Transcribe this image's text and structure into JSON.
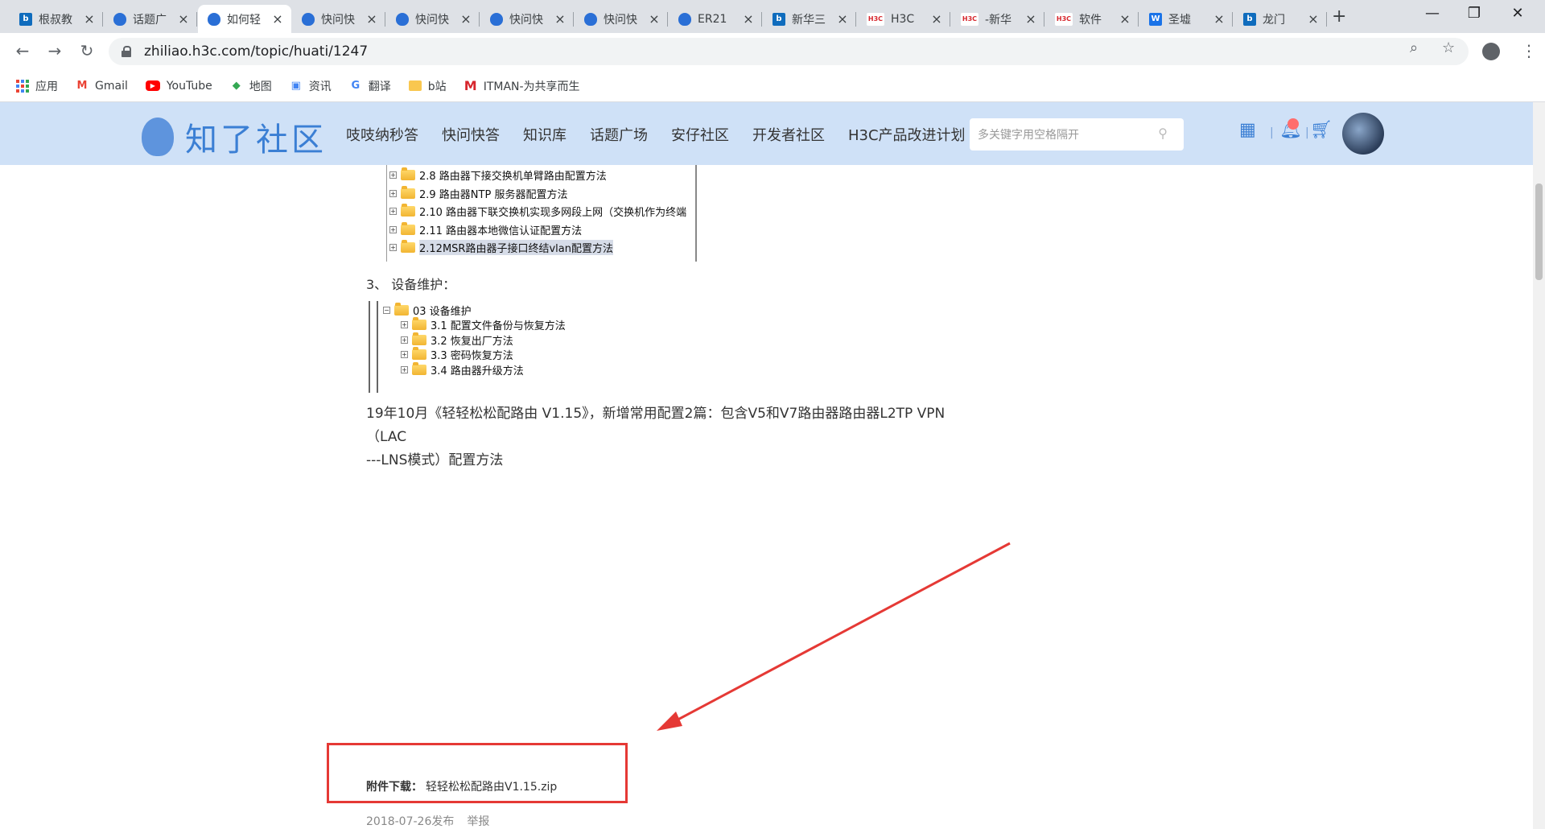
{
  "browser": {
    "tabs": [
      {
        "icon": "bing",
        "title": "根叔教"
      },
      {
        "icon": "zhiliao",
        "title": "话题广"
      },
      {
        "icon": "zhiliao",
        "title": "如何轻"
      },
      {
        "icon": "zhiliao",
        "title": "快问快"
      },
      {
        "icon": "zhiliao",
        "title": "快问快"
      },
      {
        "icon": "zhiliao",
        "title": "快问快"
      },
      {
        "icon": "zhiliao",
        "title": "快问快"
      },
      {
        "icon": "zhiliao",
        "title": "ER21"
      },
      {
        "icon": "bing",
        "title": "新华三"
      },
      {
        "icon": "h3c",
        "title": "H3C"
      },
      {
        "icon": "h3c",
        "title": "-新华"
      },
      {
        "icon": "h3c",
        "title": "软件"
      },
      {
        "icon": "wanfang",
        "title": "圣墟"
      },
      {
        "icon": "bing",
        "title": "龙门"
      }
    ],
    "active_tab_index": 2,
    "url": "zhiliao.h3c.com/topic/huati/1247",
    "bookmarks": [
      "应用",
      "Gmail",
      "YouTube",
      "地图",
      "资讯",
      "翻译",
      "b站",
      "ITMAN-为共享而生"
    ]
  },
  "site": {
    "logo_text": "知了社区",
    "nav": [
      "吱吱纳秒答",
      "快问快答",
      "知识库",
      "话题广场",
      "安仔社区",
      "开发者社区",
      "H3C产品改进计划"
    ],
    "search_placeholder": "多关键字用空格隔开",
    "separator": "|"
  },
  "content": {
    "tree1": [
      {
        "label": "2.8 路由器下接交换机单臂路由配置方法",
        "selected": false
      },
      {
        "label": "2.9 路由器NTP 服务器配置方法",
        "selected": false
      },
      {
        "label": "2.10 路由器下联交换机实现多网段上网（交换机作为终端",
        "selected": false
      },
      {
        "label": "2.11 路由器本地微信认证配置方法",
        "selected": false
      },
      {
        "label": "2.12MSR路由器子接口终结vlan配置方法",
        "selected": true
      }
    ],
    "section3_heading": "3、  设备维护：",
    "tree2_root": "03 设备维护",
    "tree2": [
      "3.1 配置文件备份与恢复方法",
      "3.2 恢复出厂方法",
      "3.3 密码恢复方法",
      "3.4 路由器升级方法"
    ],
    "paragraph_line1": "19年10月《轻轻松松配路由 V1.15》，新增常用配置2篇：包含V5和V7路由器路由器L2TP VPN（LAC",
    "paragraph_line2": "---LNS模式）配置方法",
    "attachment_label": "附件下载：",
    "attachment_file": "轻轻松松配路由V1.15.zip",
    "publish_date": "2018-07-26发布",
    "report_link": "举报"
  },
  "colors": {
    "header_bg": "#cfe1f7",
    "brand_blue": "#3b7fd4",
    "annotation_red": "#e53935"
  }
}
